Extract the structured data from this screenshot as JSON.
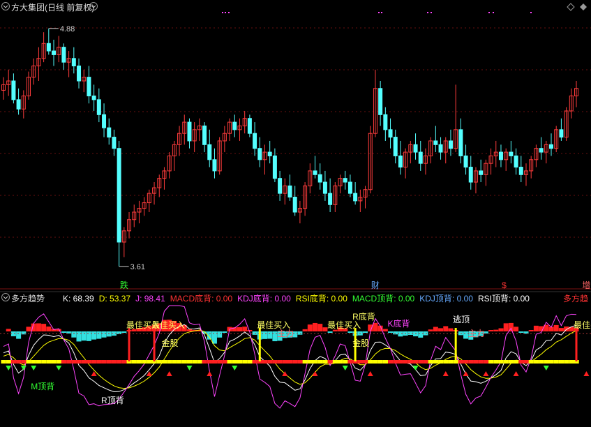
{
  "window": {
    "title": "方大集团(日线 前复权)",
    "sub_title": "多方趋势"
  },
  "icons": [
    "dropdown-icon",
    "dropdown-icon-sub",
    "diamond-icon",
    "diamond-icon-2",
    "close-x-icon"
  ],
  "indicator": {
    "name_right": "多方趋",
    "values": [
      {
        "label": "K: 68.39",
        "color": "#ffffff"
      },
      {
        "label": "D: 53.37",
        "color": "#ffff00"
      },
      {
        "label": "J: 98.41",
        "color": "#ff44ff"
      },
      {
        "label": "MACD底背: 0.00",
        "color": "#ff3333"
      },
      {
        "label": "KDJ底背: 0.00",
        "color": "#ff44ff"
      },
      {
        "label": "RSI底背: 0.00",
        "color": "#ffff00"
      },
      {
        "label": "MACD顶背: 0.00",
        "color": "#33ff33"
      },
      {
        "label": "KDJ顶背: 0.00",
        "color": "#66aaff"
      },
      {
        "label": "RSI顶背: 0.00",
        "color": "#ffffff"
      }
    ]
  },
  "chart_data": [
    {
      "type": "candlestick",
      "ylim": [
        3.55,
        4.95
      ],
      "high_label": "4.88",
      "low_label": "3.61",
      "markers": [
        {
          "text": "跌",
          "bar": 24,
          "color": "#33ff33"
        },
        {
          "text": "财",
          "bar": 74,
          "color": "#66aaff"
        },
        {
          "text": "$",
          "bar": 100,
          "color": "#ff3333"
        },
        {
          "text": "增",
          "bar": 116,
          "color": "#ff6666"
        }
      ],
      "ohlc": [
        [
          4.55,
          4.62,
          4.5,
          4.58
        ],
        [
          4.58,
          4.66,
          4.52,
          4.6
        ],
        [
          4.6,
          4.64,
          4.48,
          4.5
        ],
        [
          4.5,
          4.56,
          4.42,
          4.45
        ],
        [
          4.45,
          4.55,
          4.4,
          4.52
        ],
        [
          4.52,
          4.65,
          4.5,
          4.62
        ],
        [
          4.62,
          4.72,
          4.58,
          4.68
        ],
        [
          4.68,
          4.78,
          4.6,
          4.72
        ],
        [
          4.72,
          4.86,
          4.7,
          4.8
        ],
        [
          4.8,
          4.88,
          4.74,
          4.76
        ],
        [
          4.76,
          4.82,
          4.68,
          4.74
        ],
        [
          4.74,
          4.84,
          4.7,
          4.78
        ],
        [
          4.78,
          4.8,
          4.66,
          4.7
        ],
        [
          4.7,
          4.76,
          4.62,
          4.72
        ],
        [
          4.72,
          4.78,
          4.64,
          4.68
        ],
        [
          4.68,
          4.72,
          4.56,
          4.6
        ],
        [
          4.6,
          4.66,
          4.54,
          4.62
        ],
        [
          4.62,
          4.68,
          4.48,
          4.52
        ],
        [
          4.52,
          4.58,
          4.44,
          4.5
        ],
        [
          4.5,
          4.56,
          4.38,
          4.42
        ],
        [
          4.42,
          4.48,
          4.3,
          4.35
        ],
        [
          4.35,
          4.4,
          4.26,
          4.3
        ],
        [
          4.3,
          4.34,
          4.2,
          4.24
        ],
        [
          4.24,
          4.28,
          3.61,
          3.74
        ],
        [
          3.74,
          3.82,
          3.66,
          3.8
        ],
        [
          3.8,
          3.9,
          3.76,
          3.86
        ],
        [
          3.86,
          3.94,
          3.82,
          3.9
        ],
        [
          3.9,
          3.96,
          3.84,
          3.92
        ],
        [
          3.92,
          3.98,
          3.88,
          3.95
        ],
        [
          3.95,
          4.02,
          3.9,
          4.0
        ],
        [
          4.0,
          4.06,
          3.94,
          4.03
        ],
        [
          4.03,
          4.1,
          3.98,
          4.08
        ],
        [
          4.08,
          4.14,
          4.02,
          4.12
        ],
        [
          4.12,
          4.22,
          4.08,
          4.2
        ],
        [
          4.2,
          4.28,
          4.12,
          4.26
        ],
        [
          4.26,
          4.36,
          4.2,
          4.32
        ],
        [
          4.32,
          4.42,
          4.26,
          4.38
        ],
        [
          4.38,
          4.4,
          4.24,
          4.28
        ],
        [
          4.28,
          4.38,
          4.22,
          4.34
        ],
        [
          4.34,
          4.4,
          4.28,
          4.36
        ],
        [
          4.36,
          4.38,
          4.22,
          4.26
        ],
        [
          4.26,
          4.34,
          4.14,
          4.18
        ],
        [
          4.18,
          4.24,
          4.08,
          4.12
        ],
        [
          4.12,
          4.3,
          4.1,
          4.28
        ],
        [
          4.28,
          4.36,
          4.22,
          4.32
        ],
        [
          4.32,
          4.4,
          4.28,
          4.38
        ],
        [
          4.38,
          4.42,
          4.3,
          4.34
        ],
        [
          4.34,
          4.4,
          4.28,
          4.36
        ],
        [
          4.36,
          4.44,
          4.32,
          4.4
        ],
        [
          4.4,
          4.42,
          4.3,
          4.32
        ],
        [
          4.32,
          4.38,
          4.2,
          4.24
        ],
        [
          4.24,
          4.3,
          4.14,
          4.18
        ],
        [
          4.18,
          4.26,
          4.1,
          4.22
        ],
        [
          4.22,
          4.28,
          4.16,
          4.2
        ],
        [
          4.2,
          4.24,
          4.06,
          4.08
        ],
        [
          4.08,
          4.12,
          3.96,
          4.0
        ],
        [
          4.0,
          4.08,
          3.94,
          4.04
        ],
        [
          4.04,
          4.1,
          3.96,
          3.98
        ],
        [
          3.98,
          4.04,
          3.88,
          3.9
        ],
        [
          3.9,
          3.96,
          3.84,
          3.92
        ],
        [
          3.92,
          4.06,
          3.88,
          4.04
        ],
        [
          4.04,
          4.16,
          4.0,
          4.12
        ],
        [
          4.12,
          4.2,
          4.08,
          4.1
        ],
        [
          4.1,
          4.16,
          4.02,
          4.06
        ],
        [
          4.06,
          4.12,
          3.96,
          4.0
        ],
        [
          4.0,
          4.08,
          3.9,
          3.94
        ],
        [
          3.94,
          4.06,
          3.9,
          4.04
        ],
        [
          4.04,
          4.1,
          4.0,
          4.08
        ],
        [
          4.08,
          4.12,
          4.02,
          4.06
        ],
        [
          4.06,
          4.1,
          3.98,
          4.0
        ],
        [
          4.0,
          4.06,
          3.94,
          3.96
        ],
        [
          3.96,
          4.02,
          3.9,
          3.98
        ],
        [
          3.98,
          4.04,
          3.92,
          4.02
        ],
        [
          4.02,
          4.36,
          4.0,
          4.32
        ],
        [
          4.32,
          4.66,
          4.3,
          4.56
        ],
        [
          4.56,
          4.6,
          4.36,
          4.42
        ],
        [
          4.42,
          4.46,
          4.28,
          4.34
        ],
        [
          4.34,
          4.4,
          4.24,
          4.3
        ],
        [
          4.3,
          4.34,
          4.16,
          4.2
        ],
        [
          4.2,
          4.28,
          4.1,
          4.14
        ],
        [
          4.14,
          4.24,
          4.08,
          4.22
        ],
        [
          4.22,
          4.28,
          4.16,
          4.26
        ],
        [
          4.26,
          4.32,
          4.18,
          4.22
        ],
        [
          4.22,
          4.28,
          4.12,
          4.16
        ],
        [
          4.16,
          4.24,
          4.1,
          4.2
        ],
        [
          4.2,
          4.3,
          4.16,
          4.28
        ],
        [
          4.28,
          4.36,
          4.22,
          4.26
        ],
        [
          4.26,
          4.3,
          4.18,
          4.22
        ],
        [
          4.22,
          4.3,
          4.16,
          4.28
        ],
        [
          4.28,
          4.34,
          4.2,
          4.24
        ],
        [
          4.24,
          4.58,
          4.22,
          4.34
        ],
        [
          4.34,
          4.4,
          4.16,
          4.2
        ],
        [
          4.2,
          4.26,
          4.1,
          4.14
        ],
        [
          4.14,
          4.2,
          4.02,
          4.06
        ],
        [
          4.06,
          4.14,
          4.0,
          4.12
        ],
        [
          4.12,
          4.18,
          4.06,
          4.1
        ],
        [
          4.1,
          4.18,
          4.04,
          4.16
        ],
        [
          4.16,
          4.24,
          4.1,
          4.2
        ],
        [
          4.2,
          4.28,
          4.14,
          4.22
        ],
        [
          4.22,
          4.26,
          4.14,
          4.18
        ],
        [
          4.18,
          4.24,
          4.12,
          4.22
        ],
        [
          4.22,
          4.28,
          4.16,
          4.2
        ],
        [
          4.2,
          4.24,
          4.1,
          4.14
        ],
        [
          4.14,
          4.2,
          4.06,
          4.1
        ],
        [
          4.1,
          4.16,
          4.04,
          4.12
        ],
        [
          4.12,
          4.2,
          4.08,
          4.18
        ],
        [
          4.18,
          4.26,
          4.14,
          4.24
        ],
        [
          4.24,
          4.3,
          4.18,
          4.22
        ],
        [
          4.22,
          4.28,
          4.16,
          4.26
        ],
        [
          4.26,
          4.32,
          4.2,
          4.24
        ],
        [
          4.24,
          4.36,
          4.22,
          4.34
        ],
        [
          4.34,
          4.4,
          4.28,
          4.3
        ],
        [
          4.3,
          4.46,
          4.28,
          4.44
        ],
        [
          4.44,
          4.56,
          4.4,
          4.52
        ],
        [
          4.52,
          4.6,
          4.46,
          4.56
        ]
      ]
    },
    {
      "type": "line",
      "series": [
        {
          "name": "K",
          "color": "#ffffff"
        },
        {
          "name": "D",
          "color": "#ffff00"
        },
        {
          "name": "J",
          "color": "#ff44ff"
        }
      ],
      "labels": [
        {
          "text": "M顶背",
          "bar": 6,
          "color": "#33ff33"
        },
        {
          "text": "R顶背",
          "bar": 20,
          "color": "#ffffff"
        },
        {
          "text": "最佳买入",
          "bar": 25,
          "color": "#ffff66"
        },
        {
          "text": "最佳买入",
          "bar": 30,
          "color": "#ffff66"
        },
        {
          "text": "金股",
          "bar": 32,
          "color": "#ffff66"
        },
        {
          "text": "最佳买入",
          "bar": 51,
          "color": "#ffff66"
        },
        {
          "text": "主力",
          "bar": 55,
          "color": "#ff6666"
        },
        {
          "text": "最佳买入",
          "bar": 65,
          "color": "#ffff66"
        },
        {
          "text": "R底背",
          "bar": 70,
          "color": "#ffff66"
        },
        {
          "text": "K底背",
          "bar": 77,
          "color": "#ff44ff"
        },
        {
          "text": "金股",
          "bar": 70,
          "color": "#ffff66"
        },
        {
          "text": "逃顶",
          "bar": 90,
          "color": "#ffffff"
        },
        {
          "text": "主力",
          "bar": 93,
          "color": "#ff6666"
        },
        {
          "text": "最佳买入",
          "bar": 114,
          "color": "#ffff66"
        }
      ]
    }
  ]
}
